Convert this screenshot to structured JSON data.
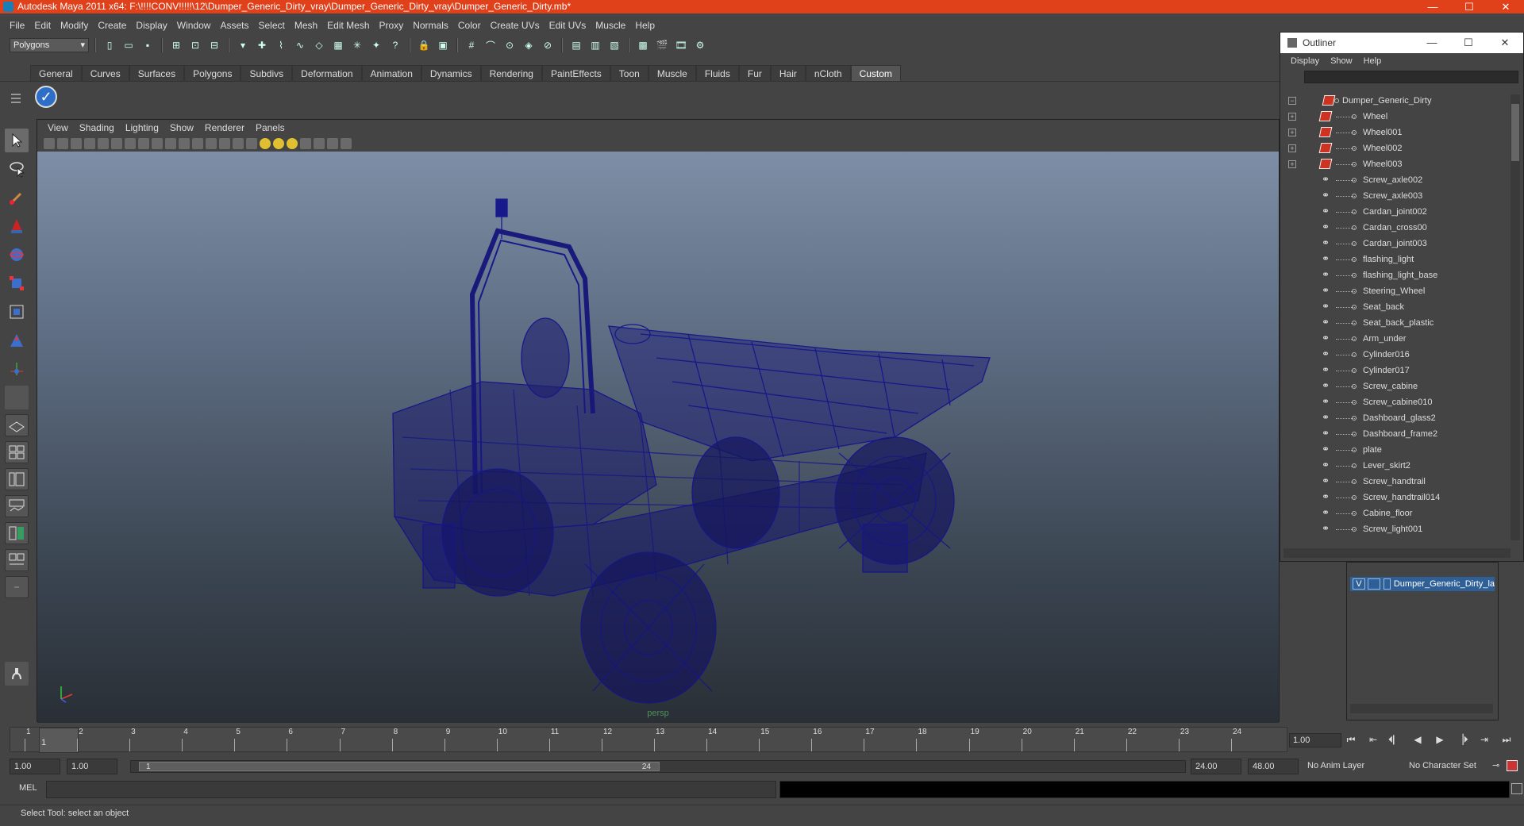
{
  "window": {
    "title": "Autodesk Maya 2011 x64: F:\\!!!!CONV!!!!!\\12\\Dumper_Generic_Dirty_vray\\Dumper_Generic_Dirty_vray\\Dumper_Generic_Dirty.mb*",
    "controls": [
      "—",
      "☐",
      "✕"
    ]
  },
  "menubar": [
    "File",
    "Edit",
    "Modify",
    "Create",
    "Display",
    "Window",
    "Assets",
    "Select",
    "Mesh",
    "Edit Mesh",
    "Proxy",
    "Normals",
    "Color",
    "Create UVs",
    "Edit UVs",
    "Muscle",
    "Help"
  ],
  "statusline": {
    "mode": "Polygons"
  },
  "shelf": {
    "tabs": [
      "General",
      "Curves",
      "Surfaces",
      "Polygons",
      "Subdivs",
      "Deformation",
      "Animation",
      "Dynamics",
      "Rendering",
      "PaintEffects",
      "Toon",
      "Muscle",
      "Fluids",
      "Fur",
      "Hair",
      "nCloth",
      "Custom"
    ],
    "active_tab": "Custom"
  },
  "viewport": {
    "menu": [
      "View",
      "Shading",
      "Lighting",
      "Show",
      "Renderer",
      "Panels"
    ],
    "camera_label": "persp"
  },
  "outliner": {
    "title": "Outliner",
    "controls": [
      "—",
      "☐",
      "✕"
    ],
    "menu": [
      "Display",
      "Show",
      "Help"
    ],
    "items": [
      {
        "label": "Dumper_Generic_Dirty",
        "type": "root",
        "expand": "−"
      },
      {
        "label": "Wheel",
        "type": "mesh",
        "expand": "+"
      },
      {
        "label": "Wheel001",
        "type": "mesh",
        "expand": "+"
      },
      {
        "label": "Wheel002",
        "type": "mesh",
        "expand": "+"
      },
      {
        "label": "Wheel003",
        "type": "mesh",
        "expand": "+"
      },
      {
        "label": "Screw_axle002",
        "type": "group"
      },
      {
        "label": "Screw_axle003",
        "type": "group"
      },
      {
        "label": "Cardan_joint002",
        "type": "group"
      },
      {
        "label": "Cardan_cross00",
        "type": "group"
      },
      {
        "label": "Cardan_joint003",
        "type": "group"
      },
      {
        "label": "flashing_light",
        "type": "group"
      },
      {
        "label": "flashing_light_base",
        "type": "group"
      },
      {
        "label": "Steering_Wheel",
        "type": "group"
      },
      {
        "label": "Seat_back",
        "type": "group"
      },
      {
        "label": "Seat_back_plastic",
        "type": "group"
      },
      {
        "label": "Arm_under",
        "type": "group"
      },
      {
        "label": "Cylinder016",
        "type": "group"
      },
      {
        "label": "Cylinder017",
        "type": "group"
      },
      {
        "label": "Screw_cabine",
        "type": "group"
      },
      {
        "label": "Screw_cabine010",
        "type": "group"
      },
      {
        "label": "Dashboard_glass2",
        "type": "group"
      },
      {
        "label": "Dashboard_frame2",
        "type": "group"
      },
      {
        "label": "plate",
        "type": "group"
      },
      {
        "label": "Lever_skirt2",
        "type": "group"
      },
      {
        "label": "Screw_handtrail",
        "type": "group"
      },
      {
        "label": "Screw_handtrail014",
        "type": "group"
      },
      {
        "label": "Cabine_floor",
        "type": "group"
      },
      {
        "label": "Screw_light001",
        "type": "group"
      }
    ]
  },
  "layers": {
    "row": {
      "visible": "V",
      "name": "Dumper_Generic_Dirty_la"
    }
  },
  "timeslider": {
    "ticks": [
      "1",
      "2",
      "3",
      "4",
      "5",
      "6",
      "7",
      "8",
      "9",
      "10",
      "11",
      "12",
      "13",
      "14",
      "15",
      "16",
      "17",
      "18",
      "19",
      "20",
      "21",
      "22",
      "23",
      "24"
    ],
    "current_frame_marker": "1",
    "current_frame": "1.00",
    "playback": [
      "⏮",
      "⇤",
      "⏴▏",
      "◀",
      "▶",
      "▕⏵",
      "⇥",
      "⏭"
    ]
  },
  "range": {
    "start": "1.00",
    "playback_start": "1.00",
    "bar_start": "1",
    "bar_end": "24",
    "playback_end": "24.00",
    "end": "48.00",
    "anim_layer": "No Anim Layer",
    "character_set": "No Character Set"
  },
  "cmdline": {
    "label": "MEL"
  },
  "helpline": {
    "text": "Select Tool: select an object"
  },
  "colors": {
    "titlebar": "#e0401a",
    "wireframe": "#14148a",
    "layer_selected": "#2e5f96"
  }
}
